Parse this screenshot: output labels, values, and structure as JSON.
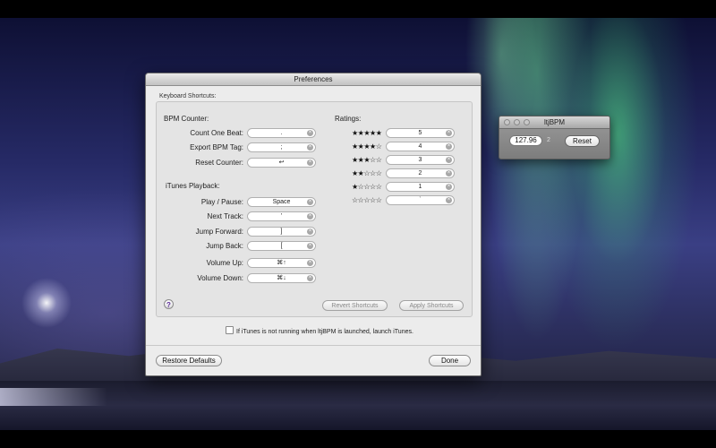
{
  "prefs": {
    "title": "Preferences",
    "group_label": "Keyboard Shortcuts:",
    "bpm_counter": {
      "heading": "BPM Counter:",
      "rows": [
        {
          "label": "Count One Beat:",
          "value": "."
        },
        {
          "label": "Export BPM Tag:",
          "value": ";"
        },
        {
          "label": "Reset Counter:",
          "value": "↩"
        }
      ]
    },
    "itunes_playback": {
      "heading": "iTunes Playback:",
      "rows": [
        {
          "label": "Play / Pause:",
          "value": "Space"
        },
        {
          "label": "Next Track:",
          "value": "'"
        },
        {
          "label": "Jump Forward:",
          "value": "]"
        },
        {
          "label": "Jump Back:",
          "value": "["
        },
        {
          "label": "Volume Up:",
          "value": "⌘↑"
        },
        {
          "label": "Volume Down:",
          "value": "⌘↓"
        }
      ]
    },
    "ratings": {
      "heading": "Ratings:",
      "rows": [
        {
          "stars": "★★★★★",
          "value": "5"
        },
        {
          "stars": "★★★★☆",
          "value": "4"
        },
        {
          "stars": "★★★☆☆",
          "value": "3"
        },
        {
          "stars": "★★☆☆☆",
          "value": "2"
        },
        {
          "stars": "★☆☆☆☆",
          "value": "1"
        },
        {
          "stars": "☆☆☆☆☆",
          "value": "`"
        }
      ]
    },
    "clear_glyph": "×",
    "help_glyph": "?",
    "revert_label": "Revert Shortcuts",
    "apply_label": "Apply Shortcuts",
    "launch_checkbox_label": "If iTunes is not running when ltjBPM is launched, launch iTunes.",
    "launch_checkbox_checked": false,
    "restore_label": "Restore Defaults",
    "done_label": "Done"
  },
  "bpm_window": {
    "title": "ltjBPM",
    "bpm_value": "127.96",
    "beat_count": "2",
    "reset_label": "Reset"
  },
  "colors": {
    "help_icon": "#5b2c9a",
    "aurora": "#5aff8c"
  }
}
